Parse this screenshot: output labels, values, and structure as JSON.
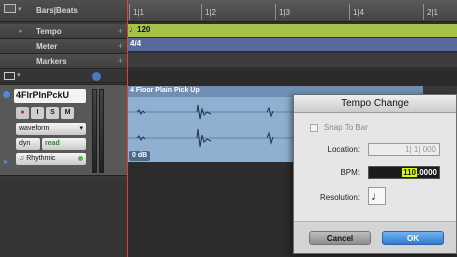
{
  "rulers": {
    "bars_beats_label": "Bars|Beats",
    "tempo_label": "Tempo",
    "meter_label": "Meter",
    "markers_label": "Markers",
    "bar_numbers": [
      "1|1",
      "1|2",
      "1|3",
      "1|4",
      "2|1"
    ],
    "tempo_value": "♩120",
    "meter_value": "4/4"
  },
  "track": {
    "name": "4FlrPlnPckU",
    "rec_label": "●",
    "input_label": "I",
    "solo_label": "S",
    "mute_label": "M",
    "view_label": "waveform",
    "dyn_label": "dyn",
    "automation_label": "read",
    "timebase_label": "Rhythmic"
  },
  "clip": {
    "name": "4 Floor Plain Pick Up",
    "gain_label": "0 dB"
  },
  "dialog": {
    "title": "Tempo Change",
    "snap_label": "Snap To Bar",
    "location_label": "Location:",
    "location_value": "1| 1| 000",
    "bpm_label": "BPM:",
    "bpm_integer": "110",
    "bpm_fraction": ".0000",
    "resolution_label": "Resolution:",
    "resolution_note": "♩",
    "cancel_label": "Cancel",
    "ok_label": "OK"
  },
  "colors": {
    "tempo_ruler": "#a7c14b",
    "meter_ruler": "#566b9a",
    "clip": "#8fb0d0",
    "ok_button": "#3a86d6",
    "bpm_highlight": "#d6ff00"
  }
}
